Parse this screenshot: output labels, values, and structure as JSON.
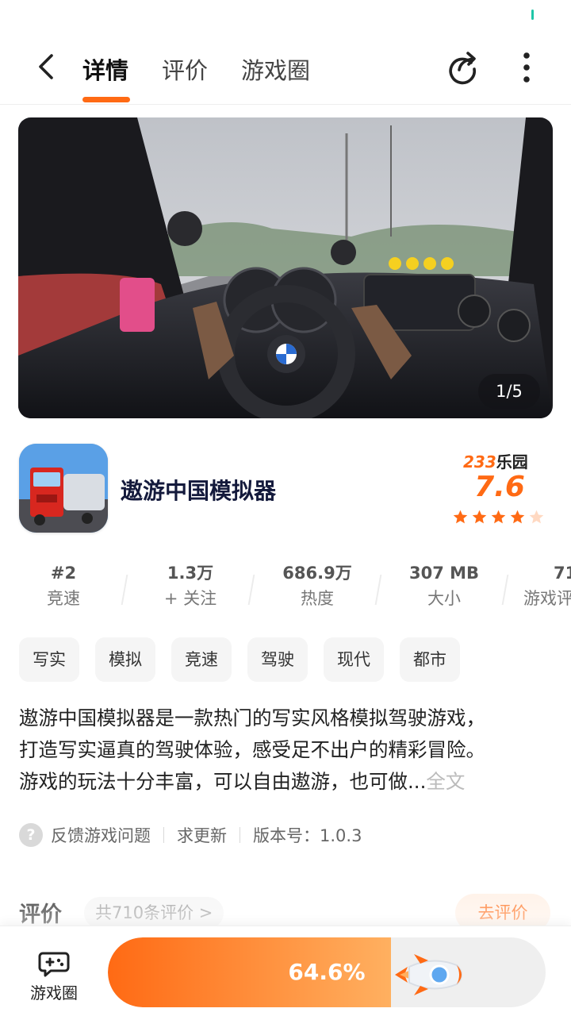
{
  "nav": {
    "tabs": [
      {
        "label": "详情",
        "active": true
      },
      {
        "label": "评价",
        "active": false
      },
      {
        "label": "游戏圈",
        "active": false
      }
    ],
    "icons": [
      "back-arrow-icon",
      "share-icon",
      "more-vertical-icon"
    ]
  },
  "banner": {
    "counter": "1/5",
    "current_slide": 1,
    "total_slides": 5
  },
  "game": {
    "title": "遨游中国模拟器",
    "rating_brand_num": "233",
    "rating_brand_text": "乐园",
    "rating_score": "7.6",
    "stars_filled": 4,
    "stars_total": 5
  },
  "stats": [
    {
      "value": "#2",
      "label": "竞速"
    },
    {
      "value": "1.3万",
      "label": "+ 关注"
    },
    {
      "value": "686.9万",
      "label": "热度"
    },
    {
      "value": "307 MB",
      "label": "大小"
    },
    {
      "value": "71",
      "label": "游戏评"
    }
  ],
  "tags": [
    "写实",
    "模拟",
    "竞速",
    "驾驶",
    "现代",
    "都市"
  ],
  "description": {
    "line1": "遨游中国模拟器是一款热门的写实风格模拟驾驶游戏，",
    "line2": "打造写实逼真的驾驶体验，感受足不出户的精彩冒险。",
    "line3": "游戏的玩法十分丰富，可以自由遨游，也可做...",
    "more": "全文"
  },
  "footer": {
    "feedback": "反馈游戏问题",
    "request_update": "求更新",
    "version": "版本号：1.0.3"
  },
  "reviews": {
    "title": "评价",
    "count": "共710条评价 >",
    "write": "去评价"
  },
  "bottom": {
    "circle_label": "游戏圈",
    "progress_text": "64.6%",
    "progress": 0.646
  },
  "colors": {
    "accent": "#ff6a14",
    "title": "#141a3c"
  }
}
